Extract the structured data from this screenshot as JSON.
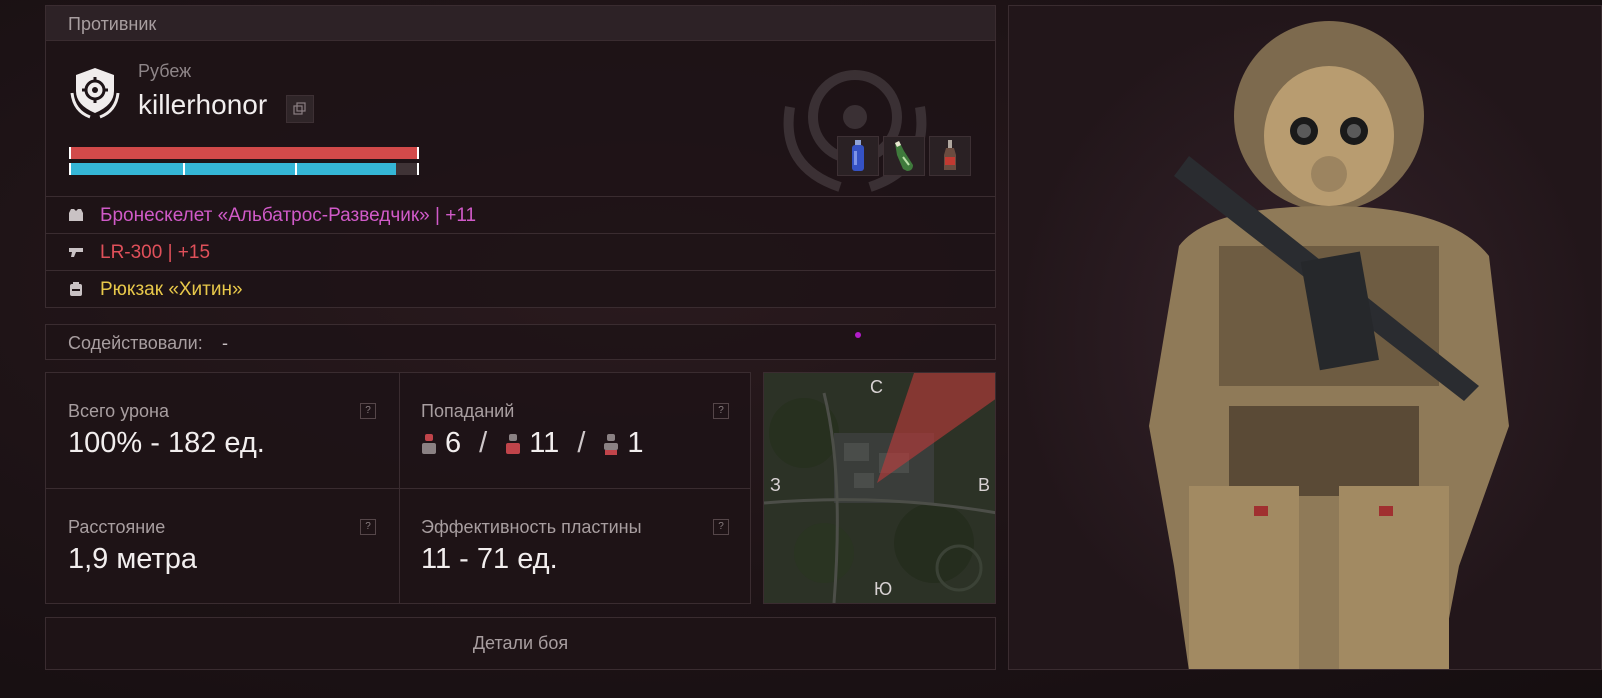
{
  "header": {
    "title": "Противник"
  },
  "enemy": {
    "subtitle": "Рубеж",
    "name": "killerhonor",
    "health_fraction": 1.0,
    "armor_fraction": 0.94,
    "armor_segments": 3,
    "consumables": [
      "blue-canister-icon",
      "green-bottle-icon",
      "red-bottle-icon"
    ]
  },
  "equipment": [
    {
      "icon": "armor-icon",
      "label": "Бронескелет «Альбатрос-Разведчик» | +11",
      "color": "#d05ac8"
    },
    {
      "icon": "rifle-icon",
      "label": "LR-300 | +15",
      "color": "#e0505a"
    },
    {
      "icon": "backpack-icon",
      "label": "Рюкзак «Хитин»",
      "color": "#e8c84a"
    }
  ],
  "assist": {
    "label": "Содействовали:",
    "value": "-"
  },
  "stats": {
    "damage": {
      "label": "Всего урона",
      "value": "100% - 182 ед.",
      "help": "?"
    },
    "hits": {
      "label": "Попаданий",
      "head": "6",
      "body": "11",
      "legs": "1",
      "separator": "/",
      "help": "?"
    },
    "distance": {
      "label": "Расстояние",
      "value": "1,9 метра",
      "help": "?"
    },
    "plate": {
      "label": "Эффективность пластины",
      "value": "11 - 71 ед.",
      "help": "?"
    }
  },
  "map": {
    "north": "С",
    "south": "Ю",
    "west": "З",
    "east": "В"
  },
  "details": {
    "label": "Детали боя"
  },
  "colors": {
    "health": "#d24a4a",
    "armor": "#35b6d6"
  }
}
